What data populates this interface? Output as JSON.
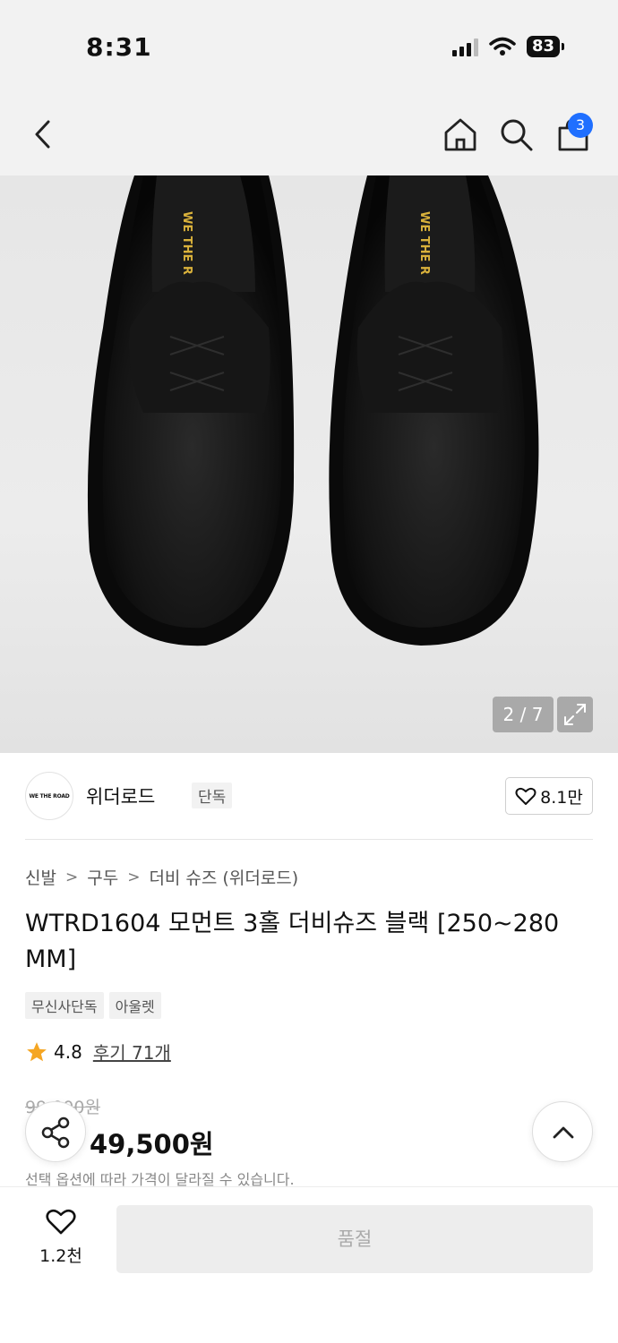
{
  "status_bar": {
    "time": "8:31",
    "battery": "83"
  },
  "nav": {
    "cart_count": "3"
  },
  "image": {
    "counter": "2 / 7"
  },
  "brand": {
    "logo_text": "WE THE ROAD",
    "name": "위더로드",
    "tag": "단독",
    "likes": "8.1만"
  },
  "breadcrumb": [
    "신발",
    "구두",
    "더비 슈즈 (위더로드)"
  ],
  "product": {
    "title": "WTRD1604 모먼트 3홀 더비슈즈 블랙 [250~280 MM]",
    "tags": [
      "무신사단독",
      "아울렛"
    ],
    "rating": "4.8",
    "reviews": "후기 71개",
    "original_price": "99,000원",
    "sale_price": "49,500원",
    "price_note": "선택 옵션에 따라 가격이 달라질 수 있습니다."
  },
  "bottom": {
    "wish_count": "1.2천",
    "buy_label": "품절"
  },
  "colors": {
    "accent_badge": "#1f6fff",
    "discount": "#ff3b30",
    "star": "#f5a623"
  }
}
